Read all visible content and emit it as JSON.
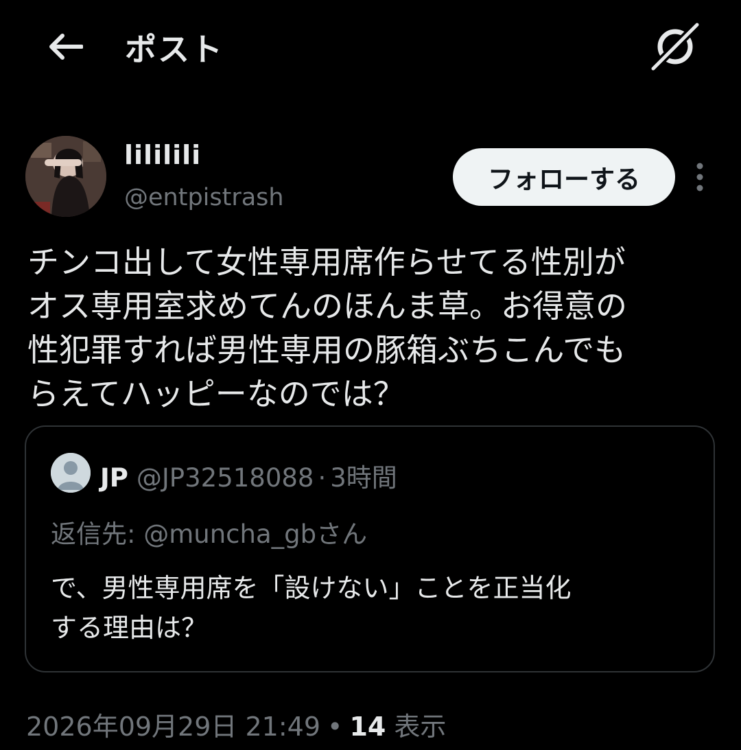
{
  "header": {
    "title": "ポスト",
    "back_icon": "arrow-left-icon",
    "grok_icon": "grok-icon"
  },
  "author": {
    "display_name": "lililili",
    "handle": "@entpistrash",
    "follow_label": "フォローする",
    "more_icon": "more-vertical-icon"
  },
  "tweet": {
    "text": "チンコ出して女性専用席作らせてる性別が\nオス専用室求めてんのほんま草。お得意の\n性犯罪すれば男性専用の豚箱ぶちこんでも\nらえてハッピーなのでは？"
  },
  "quote": {
    "name": "JP",
    "handle": "@JP32518088",
    "dot": "·",
    "time": "3時間",
    "reply_to": "返信先: @muncha_gbさん",
    "text": "で、男性専用席を「設けない」ことを正当化\nする理由は？"
  },
  "meta": {
    "datetime": "2026年09月29日 21:49",
    "separator": "•",
    "views_count": "14",
    "views_label": "表示"
  },
  "colors": {
    "background": "#000000",
    "text_primary": "#e7e9ea",
    "text_secondary": "#71767b",
    "border": "#2f3336",
    "follow_bg": "#eff3f4"
  }
}
